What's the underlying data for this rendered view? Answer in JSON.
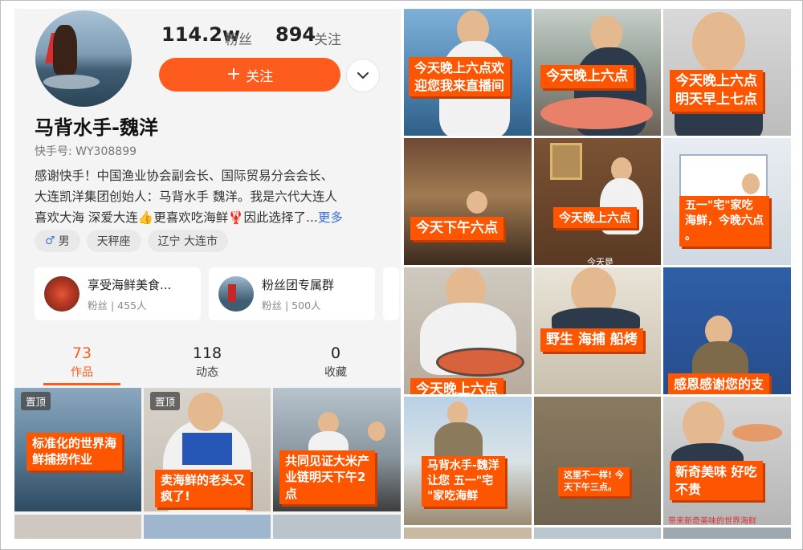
{
  "profile": {
    "fans_count": "114.2w",
    "fans_label": "粉丝",
    "following_count": "894",
    "following_label": "关注",
    "follow_button": "关注",
    "follow_plus": "+",
    "name": "马背水手-魏洋",
    "kuaishou_id": "快手号: WY308899",
    "bio_lines": [
      "感谢快手！中国渔业协会副会长、国际贸易分会会长、",
      "大连凯洋集团创始人：马背水手 魏洋。我是六代大连人",
      "喜欢大海 深爱大连👍更喜欢吃海鲜🦞因此选择了..."
    ],
    "bio_more": "更多",
    "tags": [
      {
        "icon": "male-icon",
        "symbol": "♂",
        "label": "男"
      },
      {
        "label": "天秤座"
      },
      {
        "label": "辽宁 大连市"
      }
    ],
    "groups": [
      {
        "title": "享受海鲜美食...",
        "subtitle": "粉丝 | 455人"
      },
      {
        "title": "粉丝团专属群",
        "subtitle": "粉丝 | 500人"
      }
    ],
    "tabs": [
      {
        "count": "73",
        "label": "作品",
        "active": true
      },
      {
        "count": "118",
        "label": "动态",
        "active": false
      },
      {
        "count": "0",
        "label": "收藏",
        "active": false
      }
    ]
  },
  "left_videos": [
    {
      "badge": "置顶",
      "caption": "标准化的世界海\n鲜捕捞作业"
    },
    {
      "badge": "置顶",
      "caption": "卖海鲜的老头又\n疯了!"
    },
    {
      "badge": "",
      "caption": "共同见证大米产\n业链明天下午2\n点"
    }
  ],
  "right_videos": [
    {
      "caption": "今天晚上六点欢\n迎您我来直播间"
    },
    {
      "caption": "今天晚上六点"
    },
    {
      "caption": "今天晚上六点\n明天早上七点"
    },
    {
      "caption": "今天下午六点"
    },
    {
      "caption": "今天晚上六点",
      "extra": "今天是"
    },
    {
      "caption": "五一\"宅\"家吃\n海鲜，今晚六点\n。"
    },
    {
      "caption": "今天晚上六点"
    },
    {
      "caption": "野生 海捕 船烤"
    },
    {
      "caption": "感恩感谢您的支"
    },
    {
      "caption": "马背水手-魏洋\n让您 五一\"宅\n\"家吃海鲜"
    },
    {
      "caption": "这里不一样! 今\n天下午三点。"
    },
    {
      "caption": "新奇美味 好吃\n不贵",
      "extra": "带来新奇美味的世界海鲜"
    }
  ]
}
